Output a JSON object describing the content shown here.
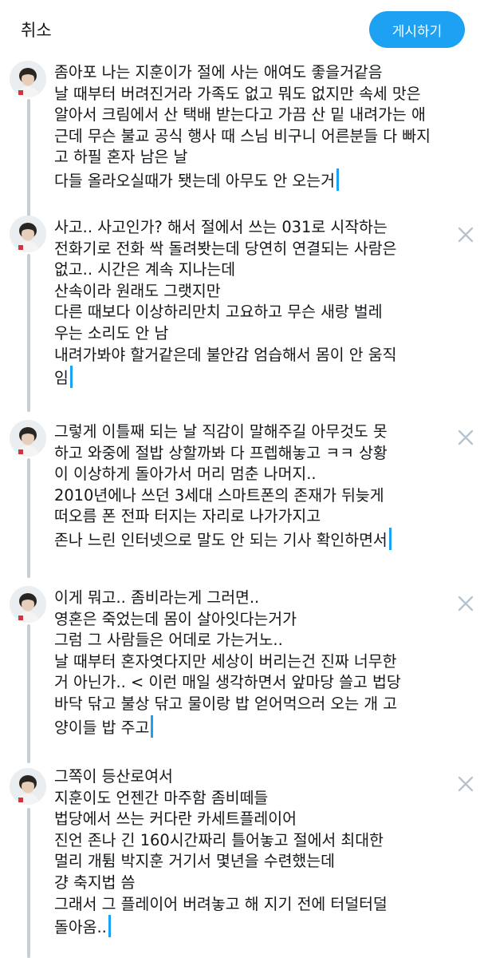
{
  "header": {
    "cancel_label": "취소",
    "post_label": "게시하기"
  },
  "colors": {
    "accent": "#1da1f2",
    "thread_line": "#c4cfd6",
    "remove_icon": "#b8c4cc"
  },
  "tweets": [
    {
      "text": "좀아포 나는 지훈이가 절에 사는 애여도 좋을거같음\n날 때부터 버려진거라 가족도 없고 뭐도 없지만 속세 맛은\n알아서 크림에서 산 택배 받는다고 가끔 산 밑 내려가는 애\n근데 무슨 불교 공식 행사 때 스님 비구니 어른분들 다 빠지\n고 하필 혼자 남은 날\n다들 올라오실때가 됏는데 아무도 안 오는거",
      "remove_icon": "close-icon"
    },
    {
      "text": "사고.. 사고인가? 해서 절에서 쓰는 031로 시작하는\n전화기로 전화 싹 돌려봣는데 당연히 연결되는 사람은\n없고.. 시간은 계속 지나는데\n산속이라 원래도 그랫지만\n다른 때보다 이상하리만치 고요하고 무슨 새랑 벌레\n우는 소리도 안 남\n내려가봐야 할거같은데 불안감 엄습해서 몸이 안 움직\n임",
      "remove_icon": "close-icon"
    },
    {
      "text": "그렇게 이틀째 되는 날 직감이 말해주길 아무것도 못\n하고 와중에 절밥 상할까봐 다 프렙해놓고 ㅋㅋ 상황\n이 이상하게 돌아가서 머리 멈춘 나머지..\n2010년에나 쓰던 3세대 스마트폰의 존재가 뒤늦게\n떠오름 폰 전파 터지는 자리로 나가가지고\n존나 느린 인터넷으로 말도 안 되는 기사 확인하면서",
      "remove_icon": "close-icon"
    },
    {
      "text": "이게 뭐고.. 좀비라는게 그러면..\n영혼은 죽었는데 몸이 살아잇다는거가\n그럼 그 사람들은 어데로 가는거노..\n날 때부터 혼자엿다지만 세상이 버리는건 진짜 너무한\n거 아닌가.. < 이런 매일 생각하면서 앞마당 쓸고 법당\n바닥 닦고 불상 닦고 물이랑 밥 얻어먹으러 오는 개 고\n양이들 밥 주고",
      "remove_icon": "close-icon"
    },
    {
      "text": "그쪽이 등산로여서\n지훈이도 언젠간 마주함 좀비떼들\n법당에서 쓰는 커다란 카세트플레이어\n진언 존나 긴 160시간짜리 틀어놓고 절에서 최대한\n멀리 개튐 박지훈 거기서 몇년을 수련했는데\n걍 축지법 씀\n그래서 그 플레이어 버려놓고 해 지기 전에 터덜터덜\n돌아옴..",
      "remove_icon": "close-icon"
    }
  ]
}
